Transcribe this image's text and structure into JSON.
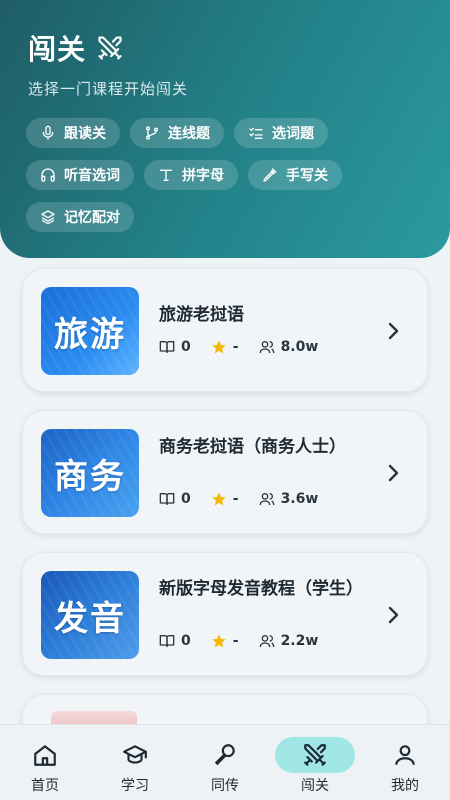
{
  "header": {
    "title": "闯关",
    "subtitle": "选择一门课程开始闯关",
    "chips": [
      {
        "label": "跟读关",
        "icon": "microphone-icon"
      },
      {
        "label": "连线题",
        "icon": "link-branch-icon"
      },
      {
        "label": "选词题",
        "icon": "checklist-icon"
      },
      {
        "label": "听音选词",
        "icon": "headphones-icon"
      },
      {
        "label": "拼字母",
        "icon": "text-t-icon"
      },
      {
        "label": "手写关",
        "icon": "pen-icon"
      },
      {
        "label": "记忆配对",
        "icon": "layers-icon"
      }
    ]
  },
  "courses": [
    {
      "title": "旅游老挝语",
      "thumb_text": "旅游",
      "lessons": "0",
      "rating": "-",
      "learners": "8.0w"
    },
    {
      "title": "商务老挝语（商务人士）",
      "thumb_text": "商务",
      "lessons": "0",
      "rating": "-",
      "learners": "3.6w"
    },
    {
      "title": "新版字母发音教程（学生）",
      "thumb_text": "发音",
      "lessons": "0",
      "rating": "-",
      "learners": "2.2w"
    }
  ],
  "nav": [
    {
      "label": "首页",
      "icon": "home-icon"
    },
    {
      "label": "学习",
      "icon": "graduation-cap-icon"
    },
    {
      "label": "同传",
      "icon": "microphone-icon"
    },
    {
      "label": "闯关",
      "icon": "crossed-swords-icon",
      "active": true
    },
    {
      "label": "我的",
      "icon": "user-icon"
    }
  ],
  "colors": {
    "header_gradient_start": "#1f5d66",
    "header_gradient_end": "#2a9aa0",
    "nav_active_bg": "#9fe6e4",
    "star": "#f5b800"
  }
}
